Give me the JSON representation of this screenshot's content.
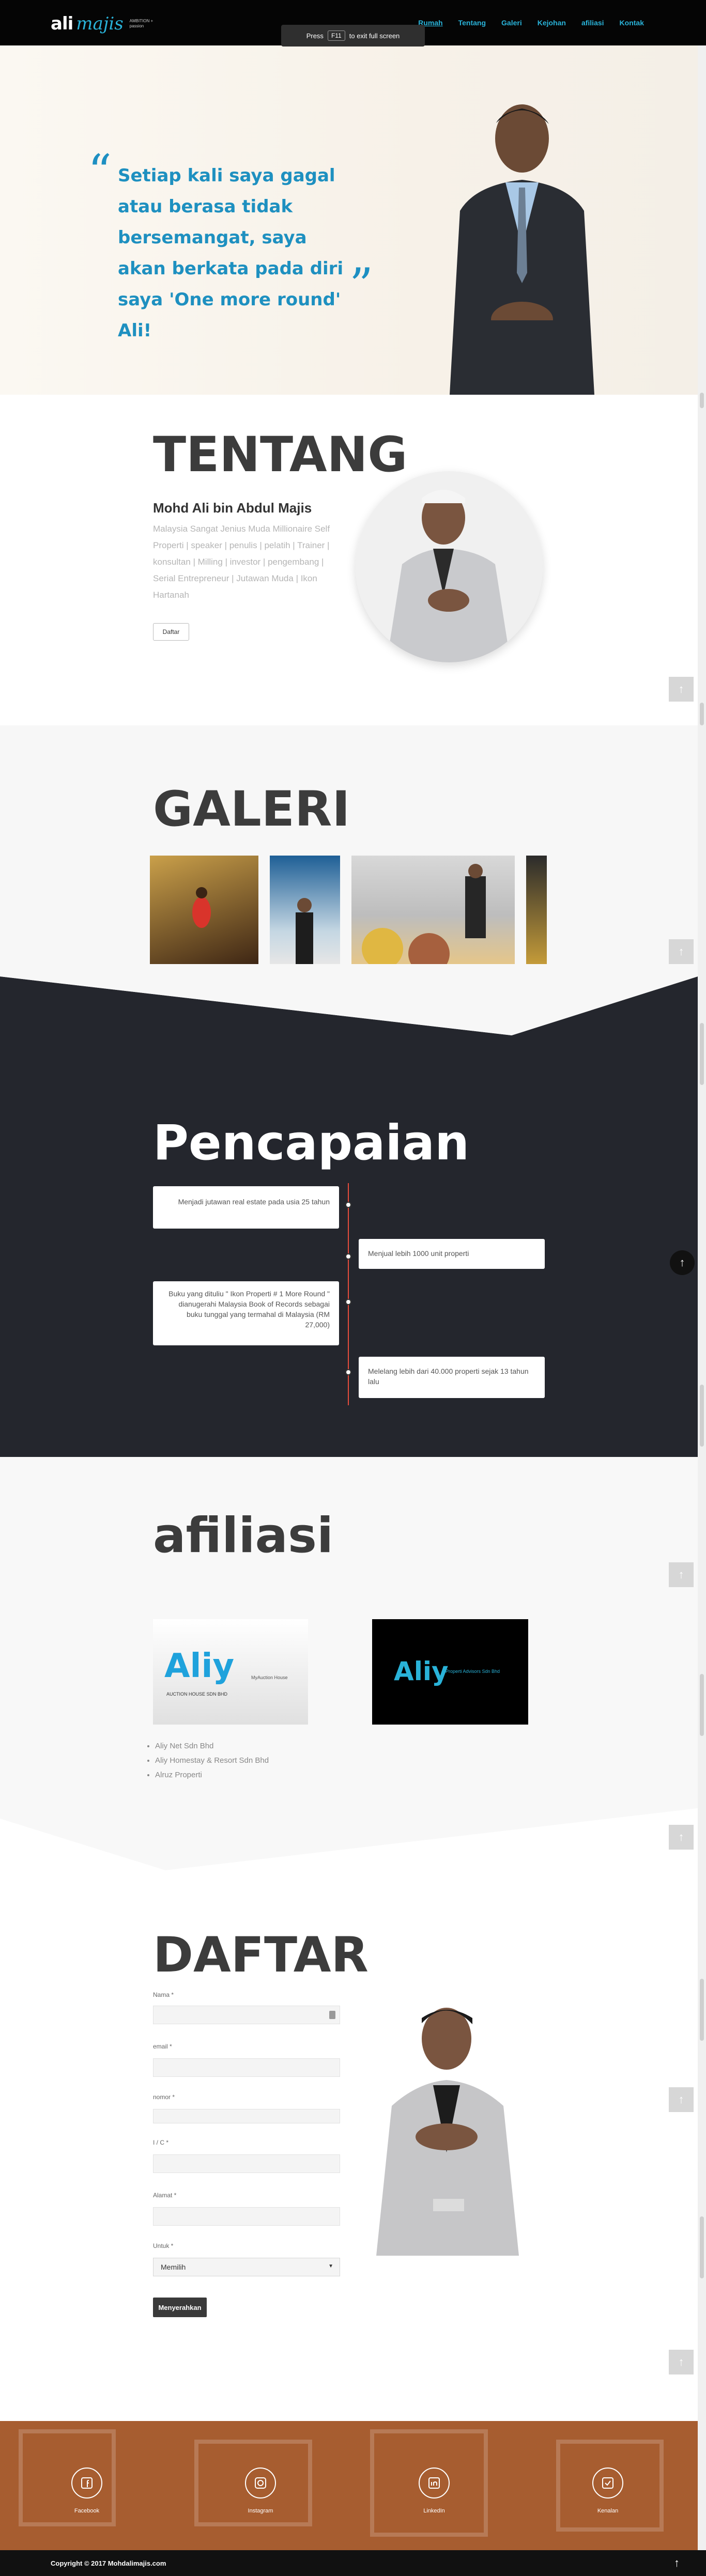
{
  "header": {
    "logo_ali": "ali",
    "logo_majis": "majis",
    "logo_tagline_1": "AMBITION +",
    "logo_tagline_2": "passion",
    "nav": [
      {
        "label": "Rumah",
        "active": true
      },
      {
        "label": "Tentang"
      },
      {
        "label": "Galeri"
      },
      {
        "label": "Kejohan"
      },
      {
        "label": "afiliasi"
      },
      {
        "label": "Kontak"
      }
    ],
    "fullscreen_prefix": "Press",
    "fullscreen_key": "F11",
    "fullscreen_suffix": "to exit full screen"
  },
  "hero": {
    "quote": "Setiap kali saya gagal atau berasa tidak bersemangat, saya akan berkata pada diri saya 'One more round' Ali!",
    "quote_open": "“",
    "quote_close": "”"
  },
  "about": {
    "title": "TENTANG",
    "name": "Mohd Ali bin Abdul Majis",
    "description": "Malaysia Sangat Jenius Muda Millionaire Self Properti | speaker | penulis | pelatih | Trainer | konsultan | Milling | investor | pengembang | Serial Entrepreneur | Jutawan Muda | Ikon Hartanah",
    "button": "Daftar"
  },
  "gallery": {
    "title": "GALERI"
  },
  "achievements": {
    "title": "Pencapaian",
    "items": [
      {
        "text": "Menjadi jutawan real estate pada usia 25 tahun",
        "side": "left"
      },
      {
        "text": "Menjual lebih 1000 unit properti",
        "side": "right"
      },
      {
        "text": "Buku yang dituliu \" Ikon Properti # 1 More Round \" dianugerahi Malaysia Book of Records sebagai buku tunggal yang termahal di Malaysia (RM 27,000)",
        "side": "left"
      },
      {
        "text": "Melelang lebih dari 40.000 properti sejak 13 tahun lalu",
        "side": "right"
      }
    ]
  },
  "affiliates": {
    "title": "afiliasi",
    "logo1_main": "Aliy",
    "logo1_sub": "AUCTION HOUSE SDN BHD",
    "logo1_side": "MyAuction House",
    "logo2_main": "Aliy",
    "logo2_sub": "Properti Advisors Sdn Bhd",
    "list": [
      "Aliy Net Sdn Bhd",
      "Aliy Homestay & Resort Sdn Bhd",
      "Alruz Properti"
    ]
  },
  "register": {
    "title": "DAFTAR",
    "fields": [
      {
        "label": "Nama *"
      },
      {
        "label": "email *"
      },
      {
        "label": "nomor *"
      },
      {
        "label": "I / C *"
      },
      {
        "label": "Alamat *"
      }
    ],
    "select_label": "Untuk *",
    "select_value": "Memilih",
    "submit": "Menyerahkan"
  },
  "footer": {
    "social": [
      {
        "label": "Facebook",
        "icon": "facebook-icon"
      },
      {
        "label": "Instagram",
        "icon": "instagram-icon"
      },
      {
        "label": "LinkedIn",
        "icon": "linkedin-icon"
      },
      {
        "label": "Kenalan",
        "icon": "contact-icon"
      }
    ],
    "copyright": "Copyright © 2017 Mohdalimajis.com"
  },
  "colors": {
    "accent": "#29b2d8",
    "dark_section": "#24262d",
    "footer": "#a75d30",
    "timeline": "#e74c3c"
  }
}
